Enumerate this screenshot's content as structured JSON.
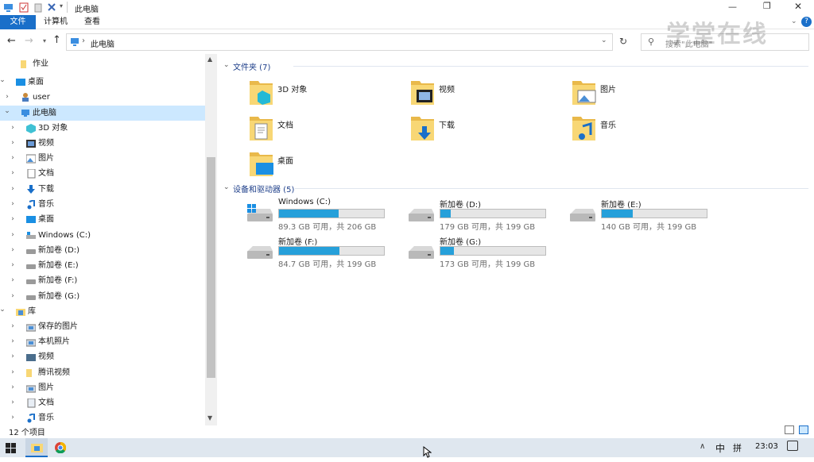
{
  "window": {
    "title": "此电脑",
    "help": "?"
  },
  "ribbon": {
    "tabs": [
      "文件",
      "计算机",
      "查看"
    ]
  },
  "address": {
    "path": "此电脑",
    "search_placeholder": "搜索\"此电脑\""
  },
  "watermark": "学堂在线",
  "sidebar": {
    "items": [
      {
        "label": "作业"
      },
      {
        "label": "桌面"
      },
      {
        "label": "user"
      },
      {
        "label": "此电脑"
      },
      {
        "label": "3D 对象"
      },
      {
        "label": "视频"
      },
      {
        "label": "图片"
      },
      {
        "label": "文档"
      },
      {
        "label": "下载"
      },
      {
        "label": "音乐"
      },
      {
        "label": "桌面"
      },
      {
        "label": "Windows (C:)"
      },
      {
        "label": "新加卷 (D:)"
      },
      {
        "label": "新加卷 (E:)"
      },
      {
        "label": "新加卷 (F:)"
      },
      {
        "label": "新加卷 (G:)"
      },
      {
        "label": "库"
      },
      {
        "label": "保存的图片"
      },
      {
        "label": "本机照片"
      },
      {
        "label": "视频"
      },
      {
        "label": "腾讯视频"
      },
      {
        "label": "图片"
      },
      {
        "label": "文档"
      },
      {
        "label": "音乐"
      }
    ]
  },
  "content": {
    "folders_header": "文件夹 (7)",
    "folders": [
      {
        "label": "3D 对象",
        "icon": "3d-objects-folder-icon"
      },
      {
        "label": "视频",
        "icon": "videos-folder-icon"
      },
      {
        "label": "图片",
        "icon": "pictures-folder-icon"
      },
      {
        "label": "文档",
        "icon": "documents-folder-icon"
      },
      {
        "label": "下载",
        "icon": "downloads-folder-icon"
      },
      {
        "label": "音乐",
        "icon": "music-folder-icon"
      },
      {
        "label": "桌面",
        "icon": "desktop-folder-icon"
      }
    ],
    "drives_header": "设备和驱动器 (5)",
    "drives": [
      {
        "name": "Windows (C:)",
        "free": "89.3 GB 可用，共 206 GB",
        "used_fraction": 0.567
      },
      {
        "name": "新加卷 (D:)",
        "free": "179 GB 可用，共 199 GB",
        "used_fraction": 0.1
      },
      {
        "name": "新加卷 (E:)",
        "free": "140 GB 可用，共 199 GB",
        "used_fraction": 0.296
      },
      {
        "name": "新加卷 (F:)",
        "free": "84.7 GB 可用，共 199 GB",
        "used_fraction": 0.574
      },
      {
        "name": "新加卷 (G:)",
        "free": "173 GB 可用，共 199 GB",
        "used_fraction": 0.13
      }
    ]
  },
  "status": {
    "item_count": "12 个项目"
  },
  "taskbar": {
    "ime_lang": "中",
    "ime_mode": "拼",
    "clock": "23:03"
  },
  "colors": {
    "accent": "#1a6fc9",
    "drive_bar": "#26a0da",
    "selection": "#cce8ff",
    "folder": "#f8d775"
  }
}
